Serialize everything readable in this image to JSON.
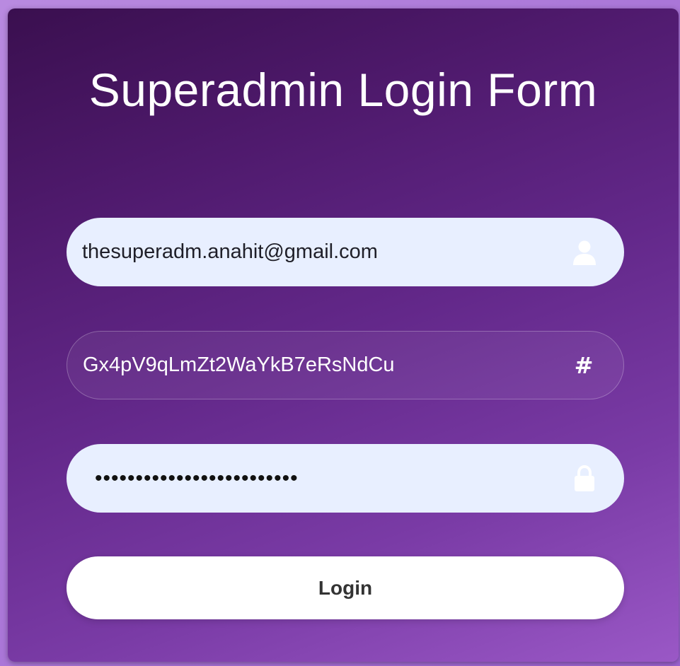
{
  "form": {
    "title": "Superadmin Login Form",
    "email": {
      "value": "thesuperadm.anahit@gmail.com",
      "icon": "user-icon"
    },
    "code": {
      "value": "Gx4pV9qLmZt2WaYkB7eRsNdCu",
      "icon": "hash-icon",
      "symbol": "#"
    },
    "password": {
      "value": "•••••••••••••••••••••••••",
      "icon": "lock-icon"
    },
    "login_label": "Login"
  },
  "colors": {
    "card_top": "#3a0f4f",
    "card_bottom": "#9a58c6",
    "field_bg": "#e8efff",
    "button_bg": "#ffffff"
  }
}
